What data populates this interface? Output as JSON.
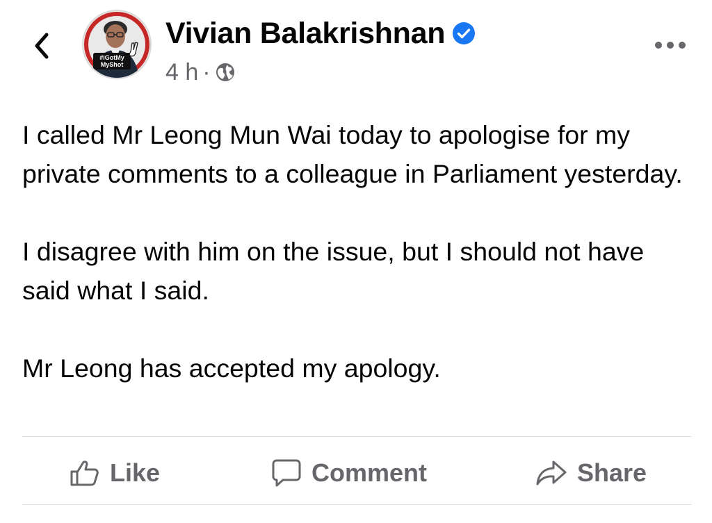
{
  "header": {
    "back_icon": "chevron-left-icon",
    "author_name": "Vivian Balakrishnan",
    "verified_icon": "verified-badge-icon",
    "timestamp": "4 h",
    "separator": "·",
    "privacy_icon": "globe-icon",
    "more_icon": "more-options-icon",
    "avatar_badge_line1": "#iGotMy",
    "avatar_badge_line2": "MyShot"
  },
  "post": {
    "paragraphs": [
      "I called Mr Leong Mun Wai today to apologise for my private comments to a colleague in Parliament yesterday.",
      "I disagree with him on the issue, but I should not have said what I said.",
      "Mr Leong has accepted my apology."
    ]
  },
  "actions": {
    "like_label": "Like",
    "comment_label": "Comment",
    "share_label": "Share"
  },
  "colors": {
    "text": "#050505",
    "secondary": "#65676b",
    "verified": "#1877f2",
    "divider": "#dadde1",
    "avatar_ring": "#c62828"
  }
}
